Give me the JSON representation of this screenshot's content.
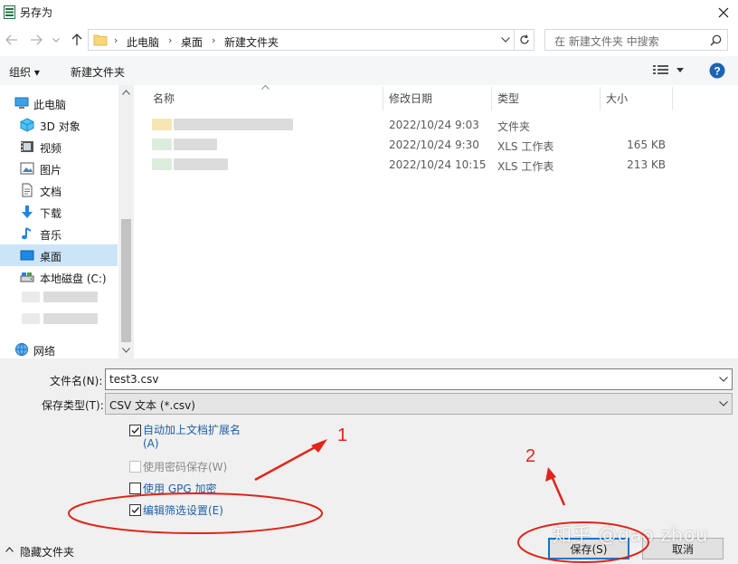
{
  "window": {
    "title": "另存为"
  },
  "address": {
    "crumbs": [
      "此电脑",
      "桌面",
      "新建文件夹"
    ],
    "search_placeholder": "在 新建文件夹 中搜索"
  },
  "toolbar": {
    "organize": "组织 ▾",
    "new_folder": "新建文件夹"
  },
  "nav": {
    "items": [
      {
        "label": "此电脑",
        "icon": "computer-icon"
      },
      {
        "label": "3D 对象",
        "icon": "cube-icon"
      },
      {
        "label": "视频",
        "icon": "video-icon"
      },
      {
        "label": "图片",
        "icon": "picture-icon"
      },
      {
        "label": "文档",
        "icon": "document-icon"
      },
      {
        "label": "下载",
        "icon": "download-icon"
      },
      {
        "label": "音乐",
        "icon": "music-icon"
      },
      {
        "label": "桌面",
        "icon": "desktop-icon",
        "selected": true
      },
      {
        "label": "本地磁盘 (C:)",
        "icon": "drive-icon"
      },
      {
        "label": "网络",
        "icon": "network-icon"
      }
    ]
  },
  "filelist": {
    "columns": [
      "名称",
      "修改日期",
      "类型",
      "大小"
    ],
    "rows": [
      {
        "date": "2022/10/24 9:03",
        "type": "文件夹",
        "size": ""
      },
      {
        "date": "2022/10/24 9:30",
        "type": "XLS 工作表",
        "size": "165 KB"
      },
      {
        "date": "2022/10/24 10:15",
        "type": "XLS 工作表",
        "size": "213 KB"
      }
    ]
  },
  "form": {
    "filename_label": "文件名(N):",
    "filename_value": "test3.csv",
    "filetype_label": "保存类型(T):",
    "filetype_value": "CSV 文本 (*.csv)"
  },
  "options": {
    "auto_ext_line1": "自动加上文档扩展名",
    "auto_ext_line2": "(A)",
    "password": "使用密码保存(W)",
    "gpg": "使用 GPG 加密",
    "filter_settings": "编辑筛选设置(E)"
  },
  "buttons": {
    "hide_folders": "隐藏文件夹",
    "save": "保存(S)",
    "cancel": "取消"
  },
  "annotations": {
    "num1": "1",
    "num2": "2",
    "color": "#e0251a"
  },
  "watermark": "知乎 @dao zhou"
}
